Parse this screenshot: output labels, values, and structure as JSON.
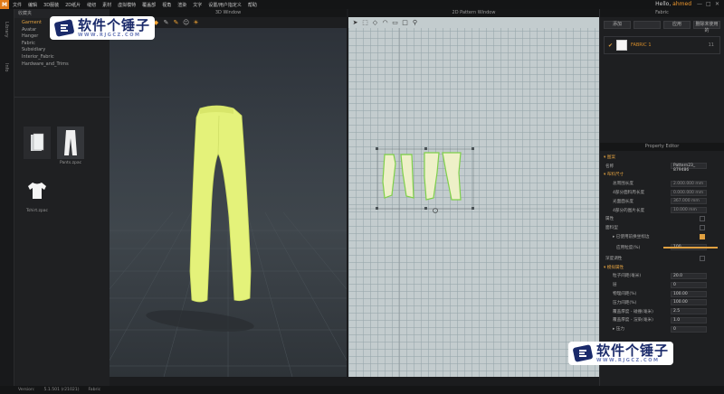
{
  "menubar": {
    "logo": "M",
    "items": [
      "文件",
      "编辑",
      "3D服装",
      "2D纸片",
      "缝纫",
      "素材",
      "虚拟模特",
      "覆盖部",
      "视角",
      "渲染",
      "文字",
      "设置/用户指定义",
      "帮助"
    ],
    "hello_prefix": "Hello,",
    "hello_user": "ahmed",
    "controls": [
      "—",
      "□",
      "✕"
    ]
  },
  "side_strip": {
    "tabs": [
      "Library",
      "Info"
    ]
  },
  "library": {
    "header": "收藏夹",
    "tree": [
      "Garment",
      "Avatar",
      "Hanger",
      "Fabric",
      "Subsidiary",
      "Interior_Fabric",
      "Hardware_and_Trims"
    ],
    "thumbs": [
      {
        "label": "",
        "icon": "folder-icon"
      },
      {
        "label": "Pants.zpac",
        "icon": "pants-icon"
      },
      {
        "label": "Tshirt.zpac",
        "icon": "tshirt-icon"
      }
    ]
  },
  "window3d": {
    "title": "3D Window"
  },
  "window2d": {
    "title": "2D Pattern Window"
  },
  "fabric_panel": {
    "title": "Fabric",
    "buttons": [
      "添加",
      "",
      "应用",
      "删除未使用的"
    ],
    "item_name": "FABRIC 1",
    "item_count": "11"
  },
  "property_editor": {
    "title": "Property Editor",
    "rows": [
      {
        "kind": "group",
        "label": "▾ 图案"
      },
      {
        "kind": "field",
        "label": "名称",
        "value": "Pattern23_ 879486",
        "light": true
      },
      {
        "kind": "group",
        "label": "▾ 布料尺寸"
      },
      {
        "kind": "indent",
        "label": "总周围长度",
        "value": "2.000.000 mm"
      },
      {
        "kind": "indent",
        "label": "4部分面料周长度",
        "value": "0.000.000 mm"
      },
      {
        "kind": "indent",
        "label": "光面面长度",
        "value": "367.000 mm"
      },
      {
        "kind": "indent",
        "label": "4部分的图片长度",
        "value": "10.000 mm"
      },
      {
        "kind": "field",
        "label": "属性",
        "check": false
      },
      {
        "kind": "field",
        "label": "面料型",
        "check": false
      },
      {
        "kind": "indent",
        "label": "▸ 已使用前换坐标边",
        "check": true
      },
      {
        "kind": "indent2",
        "label": "应用粒度(%)",
        "value": "100",
        "light": true,
        "slider": true
      },
      {
        "kind": "field",
        "label": "深度调性",
        "check": false
      },
      {
        "kind": "group",
        "label": "▾ 模拟属性"
      },
      {
        "kind": "indent",
        "label": "粒子间距(毫米)",
        "value": "20.0",
        "light": true
      },
      {
        "kind": "indent",
        "label": "层",
        "value": "0",
        "light": true
      },
      {
        "kind": "indent",
        "label": "物理间距(%)",
        "value": "100.00",
        "light": true
      },
      {
        "kind": "indent",
        "label": "压力间距(%)",
        "value": "100.00",
        "light": true
      },
      {
        "kind": "indent",
        "label": "覆盖厚度 - 碰撞(毫米)",
        "value": "2.5",
        "light": true
      },
      {
        "kind": "indent",
        "label": "覆盖厚度 - 渲染(毫米)",
        "value": "1.0",
        "light": true
      },
      {
        "kind": "indent",
        "label": "▸ 压力",
        "value": "0",
        "light": true
      }
    ]
  },
  "statusbar": {
    "items": [
      "Version:",
      "5.1.501 (r21021)",
      "Fabric"
    ]
  },
  "watermark": {
    "main": "软件个锤子",
    "sub": "WWW.RJGCZ.COM"
  },
  "colors": {
    "accent": "#e0a040",
    "garment": "#e4f27a",
    "watermark_blue": "#1a2a6a"
  }
}
